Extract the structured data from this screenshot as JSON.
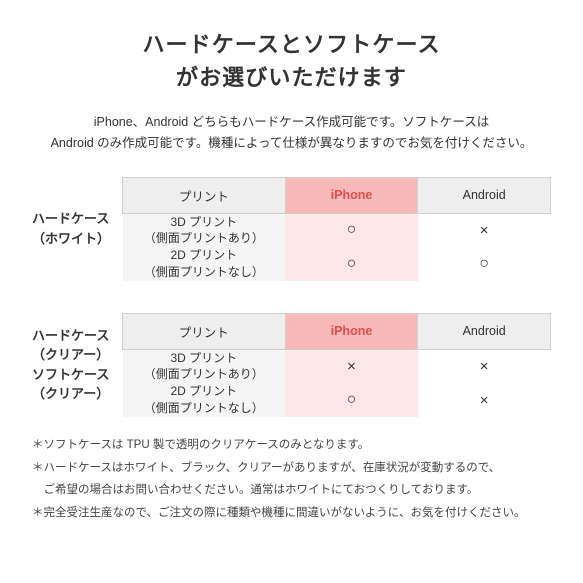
{
  "title_line1": "ハードケースとソフトケース",
  "title_line2": "がお選びいただけます",
  "subtitle": "iPhone、Android どちらもハードケース作成可能です。ソフトケースは\nAndroid のみ作成可能です。機種によって仕様が異なりますのでお気を付けください。",
  "table1": {
    "section_label_line1": "ハードケース",
    "section_label_line2": "（ホワイト）",
    "col_print": "プリント",
    "col_iphone": "iPhone",
    "col_android": "Android",
    "rows": [
      {
        "print": "3D プリント\n（側面プリントあり）",
        "iphone": "○",
        "android": "×"
      },
      {
        "print": "2D プリント\n（側面プリントなし）",
        "iphone": "○",
        "android": "○"
      }
    ]
  },
  "table2": {
    "section_label1_line1": "ハードケース",
    "section_label1_line2": "（クリアー）",
    "section_label2_line1": "ソフトケース",
    "section_label2_line2": "（クリアー）",
    "col_print": "プリント",
    "col_iphone": "iPhone",
    "col_android": "Android",
    "rows": [
      {
        "print": "3D プリント\n（側面プリントあり）",
        "iphone": "×",
        "android": "×"
      },
      {
        "print": "2D プリント\n（側面プリントなし）",
        "iphone": "○",
        "android": "×"
      }
    ]
  },
  "notes": [
    "＊ソフトケースは TPU 製で透明のクリアケースのみとなります。",
    "＊ハードケースはホワイト、ブラック、クリアーがありますが、在庫状況が変動するので、",
    "　ご希望の場合はお問い合わせください。通常はホワイトにておつくりしております。",
    "＊完全受注生産なので、ご注文の際に種類や機種に間違いがないように、お気を付けください。"
  ]
}
